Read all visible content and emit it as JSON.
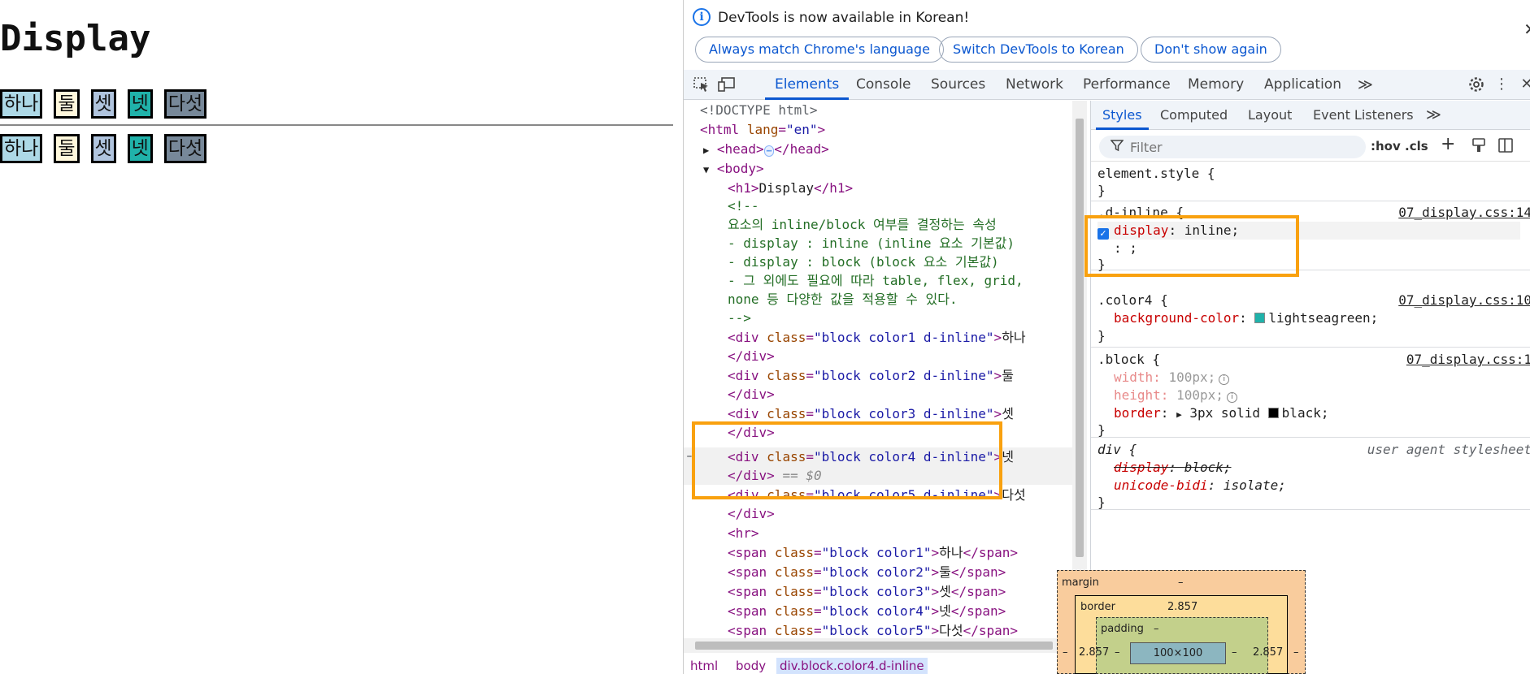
{
  "page": {
    "heading": "Display",
    "row1": [
      "하나",
      "둘",
      "셋",
      "넷",
      "다섯"
    ],
    "row2": [
      "하나",
      "둘",
      "셋",
      "넷",
      "다섯"
    ],
    "colors": {
      "color1": "#add8e6",
      "color2": "#fff8dc",
      "color3": "#b0c4de",
      "color4": "#20b2aa",
      "color5": "#778899"
    }
  },
  "infobar": {
    "message": "DevTools is now available in Korean!",
    "buttons": [
      "Always match Chrome's language",
      "Switch DevTools to Korean",
      "Don't show again"
    ],
    "close": "✕"
  },
  "tabs": {
    "items": [
      "Elements",
      "Console",
      "Sources",
      "Network",
      "Performance",
      "Memory",
      "Application"
    ],
    "more": "≫",
    "active": "Elements"
  },
  "elements": {
    "doctype": "<!DOCTYPE html>",
    "html_tag": "<html",
    "html_lang_attr": "lang",
    "html_lang_val": "\"en\"",
    "html_close": ">",
    "head_open": "<head>",
    "head_ellipsis": "⋯",
    "head_close": "</head>",
    "body_open": "<body>",
    "h1_open": "<h1>",
    "h1_text": "Display",
    "h1_close": "</h1>",
    "comment": [
      "<!--",
      "요소의 inline/block 여부를 결정하는 속성",
      "- display : inline (inline 요소 기본값)",
      "- display : block (block 요소 기본값)",
      "- 그 외에도 필요에 따라 table, flex, grid,",
      "none 등 다양한 값을 적용할 수 있다.",
      "-->"
    ],
    "divs": [
      {
        "cls": "\"block color1 d-inline\"",
        "text": "하나"
      },
      {
        "cls": "\"block color2 d-inline\"",
        "text": "둘"
      },
      {
        "cls": "\"block color3 d-inline\"",
        "text": "셋"
      },
      {
        "cls": "\"block color4 d-inline\"",
        "text": "넷"
      },
      {
        "cls": "\"block color5 d-inline\"",
        "text": "다섯"
      }
    ],
    "div_open": "<div",
    "class_attr": "class",
    "div_close": "</div>",
    "selected_marker": "== $0",
    "hr": "<hr>",
    "spans": [
      {
        "cls": "\"block color1\"",
        "text": "하나"
      },
      {
        "cls": "\"block color2\"",
        "text": "둘"
      },
      {
        "cls": "\"block color3\"",
        "text": "셋"
      },
      {
        "cls": "\"block color4\"",
        "text": "넷"
      },
      {
        "cls": "\"block color5\"",
        "text": "다섯"
      }
    ],
    "span_open": "<span",
    "span_close": "</span>",
    "dots": "⋯"
  },
  "breadcrumb": [
    "html",
    "body",
    "div.block.color4.d-inline"
  ],
  "styles": {
    "subtabs": [
      "Styles",
      "Computed",
      "Layout",
      "Event Listeners"
    ],
    "subtabs_more": "≫",
    "filter_placeholder": "Filter",
    "hov": ":hov",
    "cls": ".cls",
    "element_style_open": "element.style {",
    "close_brace": "}",
    "rule1": {
      "selector": ".d-inline {",
      "source": "07_display.css:14",
      "prop": "display",
      "value": "inline;",
      "editing": ": ;"
    },
    "rule2": {
      "selector": ".color4 {",
      "source": "07_display.css:10",
      "prop": "background-color",
      "value": "lightseagreen;",
      "swatch": "#20b2aa"
    },
    "rule3": {
      "selector": ".block {",
      "source": "07_display.css:1",
      "props": [
        {
          "prop": "width",
          "value": "100px;"
        },
        {
          "prop": "height",
          "value": "100px;"
        },
        {
          "prop": "border",
          "value": "3px solid",
          "extra": "black;"
        }
      ]
    },
    "rule4": {
      "selector": "div {",
      "source": "user agent stylesheet",
      "props": [
        {
          "prop": "display",
          "value": "block;"
        },
        {
          "prop": "unicode-bidi",
          "value": "isolate;"
        }
      ]
    }
  },
  "boxmodel": {
    "margin_label": "margin",
    "margin_val": "–",
    "border_label": "border",
    "border_val": "2.857",
    "padding_label": "padding",
    "padding_val": "–",
    "content": "100×100",
    "left_margin": "–",
    "right_margin": "–",
    "left_border": "2.857",
    "right_border": "2.857",
    "left_padding": "–",
    "right_padding": "–"
  }
}
